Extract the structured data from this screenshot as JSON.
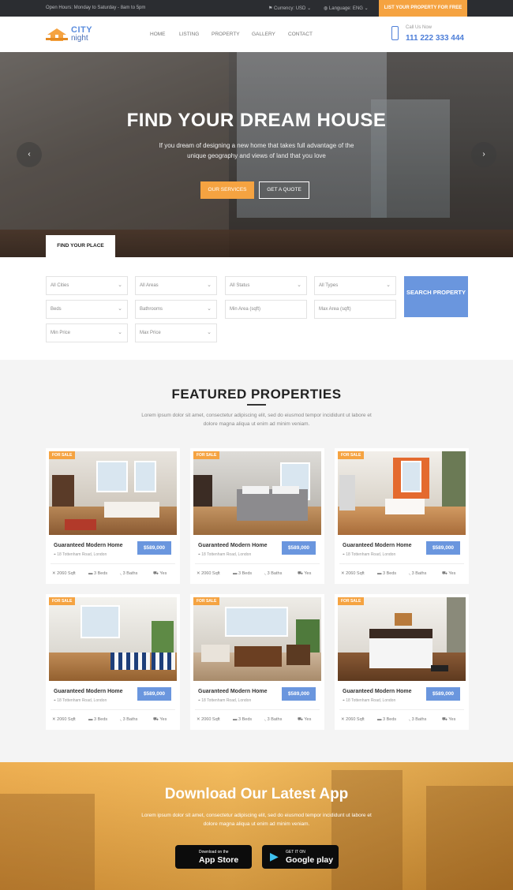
{
  "topbar": {
    "hours": "Open Hours: Monday to Saturday - 8am to 5pm",
    "currency": "Currency: USD",
    "language": "Language: ENG",
    "list_button": "LIST YOUR PROPERTY FOR FREE"
  },
  "brand": {
    "line1": "CITY",
    "line2": "night"
  },
  "nav": [
    "HOME",
    "LISTING",
    "PROPERTY",
    "GALLERY",
    "CONTACT"
  ],
  "contact": {
    "label": "Call Us Now",
    "phone": "111 222 333 444"
  },
  "hero": {
    "title": "FIND YOUR DREAM HOUSE",
    "subtitle": "If you dream of designing a new home that takes full advantage of the unique geography and views of land that you love",
    "primary_button": "OUR SERVICES",
    "secondary_button": "GET A QUOTE",
    "tab_label": "FIND YOUR PLACE",
    "prev_arrow": "‹",
    "next_arrow": "›"
  },
  "search": {
    "fields": [
      {
        "label": "All Cities",
        "dropdown": true
      },
      {
        "label": "All Areas",
        "dropdown": true
      },
      {
        "label": "All Status",
        "dropdown": true
      },
      {
        "label": "All Types",
        "dropdown": true
      },
      {
        "label": "Beds",
        "dropdown": true
      },
      {
        "label": "Bathrooms",
        "dropdown": true
      },
      {
        "label": "Min Area (sqft)",
        "dropdown": false
      },
      {
        "label": "Max Area (sqft)",
        "dropdown": false
      },
      {
        "label": "Min Price",
        "dropdown": true
      },
      {
        "label": "Max Price",
        "dropdown": true
      }
    ],
    "button": "SEARCH PROPERTY"
  },
  "featured": {
    "title": "FEATURED PROPERTIES",
    "intro": "Lorem ipsum dolor sit amet, consectetur adipiscing elit, sed do eiusmod tempor incididunt ut labore et dolore magna aliqua ut enim ad minim veniam.",
    "cards": [
      {
        "badge": "FOR SALE",
        "title": "Guaranteed Modern Home",
        "address": "18 Tottenham Road, London",
        "price": "$589,000",
        "area": "2060 Sqft",
        "beds": "3 Beds",
        "baths": "3 Baths",
        "garage": "Yes"
      },
      {
        "badge": "FOR SALE",
        "title": "Guaranteed Modern Home",
        "address": "18 Tottenham Road, London",
        "price": "$589,000",
        "area": "2060 Sqft",
        "beds": "3 Beds",
        "baths": "3 Baths",
        "garage": "Yes"
      },
      {
        "badge": "FOR SALE",
        "title": "Guaranteed Modern Home",
        "address": "18 Tottenham Road, London",
        "price": "$589,000",
        "area": "2060 Sqft",
        "beds": "3 Beds",
        "baths": "3 Baths",
        "garage": "Yes"
      },
      {
        "badge": "FOR SALE",
        "title": "Guaranteed Modern Home",
        "address": "18 Tottenham Road, London",
        "price": "$589,000",
        "area": "2060 Sqft",
        "beds": "3 Beds",
        "baths": "3 Baths",
        "garage": "Yes"
      },
      {
        "badge": "FOR SALE",
        "title": "Guaranteed Modern Home",
        "address": "18 Tottenham Road, London",
        "price": "$589,000",
        "area": "2060 Sqft",
        "beds": "3 Beds",
        "baths": "3 Baths",
        "garage": "Yes"
      },
      {
        "badge": "FOR SALE",
        "title": "Guaranteed Modern Home",
        "address": "18 Tottenham Road, London",
        "price": "$589,000",
        "area": "2060 Sqft",
        "beds": "3 Beds",
        "baths": "3 Baths",
        "garage": "Yes"
      }
    ]
  },
  "app": {
    "title": "Download Our Latest App",
    "subtitle": "Lorem ipsum dolor sit amet, consectetur adipiscing elit, sed do eiusmod tempor incididunt ut labore et dolore magna aliqua ut enim ad minim veniam.",
    "appstore_small": "Download on the",
    "appstore_big": "App Store",
    "googleplay_small": "GET IT ON",
    "googleplay_big": "Google play"
  },
  "colors": {
    "accent": "#f5a341",
    "primary": "#6a96de",
    "dark": "#2b2d31"
  },
  "icons": [
    "flag-icon",
    "globe-icon",
    "phone-icon",
    "house-logo-icon",
    "area-icon",
    "bed-icon",
    "bath-icon",
    "car-icon",
    "apple-icon",
    "play-icon"
  ]
}
